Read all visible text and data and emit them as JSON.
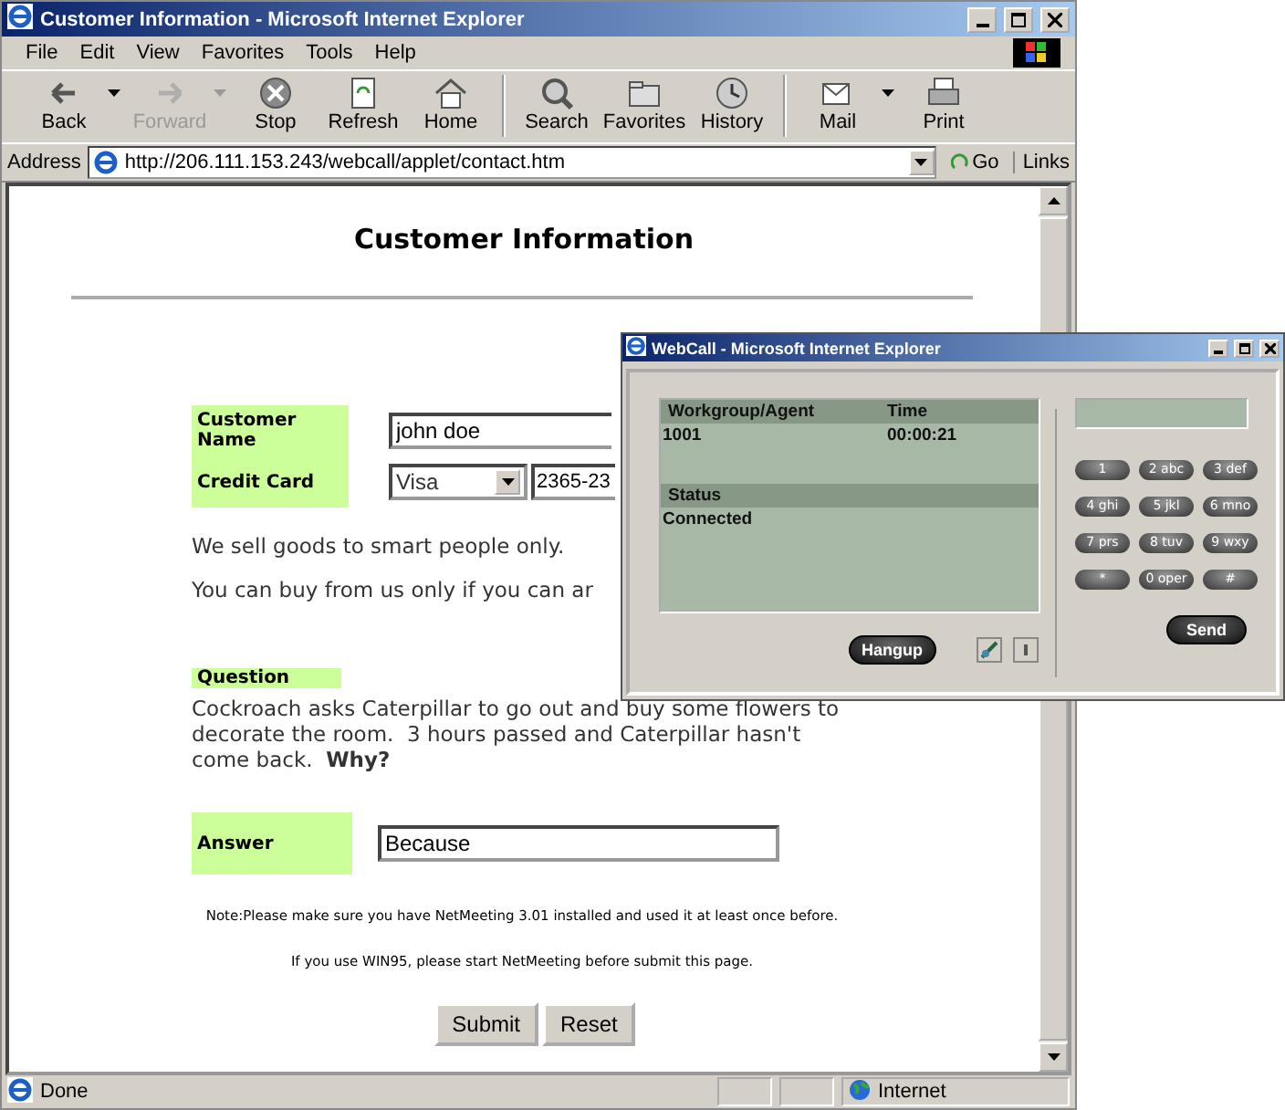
{
  "browser": {
    "title": "Customer Information - Microsoft Internet Explorer",
    "menu": [
      "File",
      "Edit",
      "View",
      "Favorites",
      "Tools",
      "Help"
    ],
    "toolbar": [
      {
        "label": "Back",
        "disabled": false,
        "dropdown": true
      },
      {
        "label": "Forward",
        "disabled": true,
        "dropdown": true
      },
      {
        "label": "Stop",
        "disabled": false,
        "dropdown": false
      },
      {
        "label": "Refresh",
        "disabled": false,
        "dropdown": false
      },
      {
        "label": "Home",
        "disabled": false,
        "dropdown": false
      },
      {
        "label": "Search",
        "disabled": false,
        "dropdown": false
      },
      {
        "label": "Favorites",
        "disabled": false,
        "dropdown": false
      },
      {
        "label": "History",
        "disabled": false,
        "dropdown": false
      },
      {
        "label": "Mail",
        "disabled": false,
        "dropdown": true
      },
      {
        "label": "Print",
        "disabled": false,
        "dropdown": false
      }
    ],
    "address": {
      "label": "Address",
      "url": "http://206.111.153.243/webcall/applet/contact.htm",
      "go": "Go",
      "links": "Links"
    },
    "status_bar": {
      "text": "Done",
      "zone": "Internet"
    }
  },
  "page": {
    "heading": "Customer Information",
    "fields": [
      {
        "label": "Customer Name",
        "kind": "text",
        "value": "john doe"
      },
      {
        "label": "Credit Card",
        "kind": "card",
        "card_type": "Visa",
        "value": "2365-23"
      }
    ],
    "paragraphs": [
      "We sell goods to smart people only.",
      "You can buy from us only if you can ar"
    ],
    "question": {
      "label": "Question",
      "text": "Cockroach asks Caterpillar to go out and buy some flowers to decorate the room.  3 hours passed and Caterpillar hasn't come back.  **Why?**"
    },
    "answer": {
      "label": "Answer",
      "value": "Because"
    },
    "notes": [
      "Note:Please make sure you have NetMeeting 3.01 installed and used it at least once before.",
      "If you use WIN95, please start NetMeeting before submit this page."
    ],
    "buttons": [
      "Submit",
      "Reset"
    ]
  },
  "popup": {
    "title": "WebCall - Microsoft Internet Explorer",
    "columns": [
      "Workgroup/Agent",
      "Time"
    ],
    "row": [
      "1001",
      "00:00:21"
    ],
    "status_label": "Status",
    "status": "Connected",
    "keys": [
      "1",
      "2 abc",
      "3 def",
      "4 ghi",
      "5 jkl",
      "6 mno",
      "7 prs",
      "8 tuv",
      "9 wxy",
      "*",
      "0 oper",
      "#"
    ],
    "hangup": "Hangup",
    "send": "Send"
  }
}
